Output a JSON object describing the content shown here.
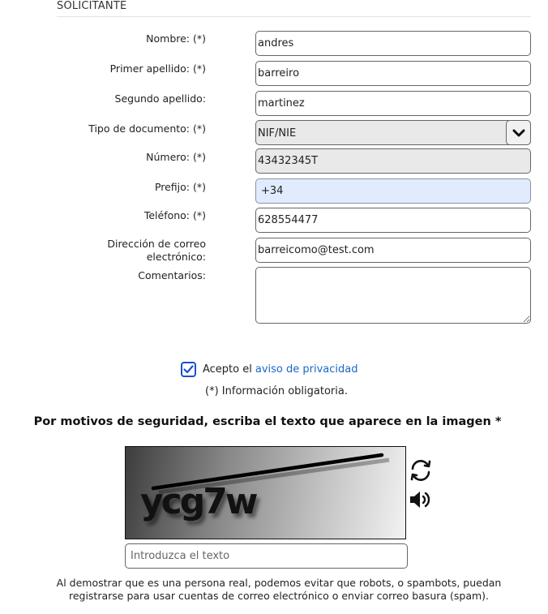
{
  "section": {
    "title": "SOLICITANTE"
  },
  "fields": {
    "nombre": {
      "label": "Nombre: (*)",
      "value": "andres"
    },
    "primer_apellido": {
      "label": "Primer apellido: (*)",
      "value": "barreiro"
    },
    "segundo_apellido": {
      "label": "Segundo apellido:",
      "value": "martinez"
    },
    "tipo_documento": {
      "label": "Tipo de documento: (*)",
      "value": "NIF/NIE"
    },
    "numero": {
      "label": "Número: (*)",
      "value": "43432345T"
    },
    "prefijo": {
      "label": "Prefijo: (*)",
      "value": "+34"
    },
    "telefono": {
      "label": "Teléfono: (*)",
      "value": "628554477"
    },
    "email": {
      "label_line1": "Dirección de correo",
      "label_line2": "electrónico:",
      "value": "barreicomo@test.com"
    },
    "comentarios": {
      "label": "Comentarios:",
      "value": ""
    }
  },
  "privacy": {
    "checked": true,
    "text": "Acepto el",
    "link": "aviso de privacidad"
  },
  "mandatory_note": "(*) Información obligatoria.",
  "captcha": {
    "title": "Por motivos de seguridad, escriba el texto que aparece en la imagen *",
    "image_text": "ycg7w",
    "refresh_icon": "refresh-icon",
    "audio_icon": "speaker-icon",
    "input_placeholder": "Introduzca el texto",
    "input_value": "",
    "info_line1": "Al demostrar que es una persona real, podemos evitar que robots, o spambots, puedan",
    "info_line2": "registrarse para usar cuentas de correo electrónico o enviar correo basura (spam)."
  }
}
